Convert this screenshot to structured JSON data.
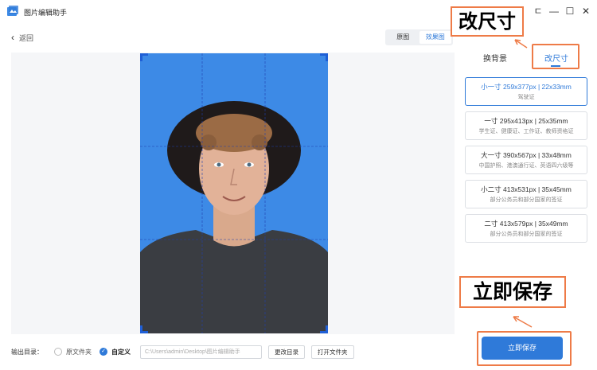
{
  "app": {
    "title": "图片编辑助手"
  },
  "window": {
    "pin": "ㄷ",
    "minimize": "—",
    "maximize": "☐",
    "close": "✕"
  },
  "nav": {
    "back_label": "返回"
  },
  "view_toggle": {
    "original": "原图",
    "effect": "效果图"
  },
  "tabs": {
    "change_bg": "换背景",
    "change_size": "改尺寸"
  },
  "sizes": [
    {
      "title": "小一寸 259x377px | 22x33mm",
      "desc": "驾驶证",
      "active": true
    },
    {
      "title": "一寸 295x413px | 25x35mm",
      "desc": "学生证、健康证、工作证、教师资格证"
    },
    {
      "title": "大一寸 390x567px | 33x48mm",
      "desc": "中国护照、港澳通行证、英语四六级等"
    },
    {
      "title": "小二寸 413x531px | 35x45mm",
      "desc": "部分公务员和部分国家的签证"
    },
    {
      "title": "二寸 413x579px | 35x49mm",
      "desc": "部分公务员和部分国家的签证"
    }
  ],
  "annotations": {
    "size_callout": "改尺寸",
    "save_callout": "立即保存"
  },
  "bottom": {
    "output_label": "输出目录：",
    "opt_original": "原文件夹",
    "opt_custom": "自定义",
    "path_value": "C:\\Users\\admin\\Desktop\\图片编辑助手",
    "change_dir": "更改目录",
    "open_folder": "打开文件夹"
  },
  "save_button": "立即保存",
  "colors": {
    "accent": "#2f7ad9",
    "photo_bg": "#3d8ae6",
    "callout": "#ee7b47"
  }
}
